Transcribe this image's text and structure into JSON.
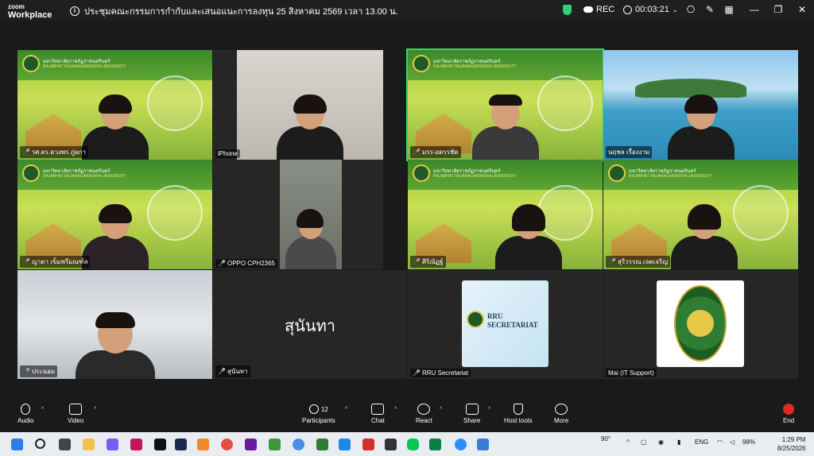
{
  "brand": {
    "line1": "zoom",
    "line2": "Workplace"
  },
  "meeting": {
    "title": "ประชุมคณะกรรมการกำกับและเสนอแนะการลงทุน 25 สิงหาคม 2569 เวลา 13.00 น."
  },
  "status": {
    "rec_label": "REC",
    "timer": "00:03:21"
  },
  "participants": [
    {
      "name": "รศ.ดร.ดวงพร ภู่ผกา",
      "muted": true
    },
    {
      "name": "iPhone",
      "muted": false
    },
    {
      "name": "มรร-อดรรชัด",
      "muted": true
    },
    {
      "name": "นฤชล เรื่องงาม",
      "muted": false
    },
    {
      "name": "ญาดา เข็มพรีมณฑ์ล",
      "muted": true
    },
    {
      "name": "OPPO CPH2365",
      "muted": true
    },
    {
      "name": "ศิริณัฏฐ์",
      "muted": true
    },
    {
      "name": "สุรีวรรณ เจตเจริญ",
      "muted": true
    },
    {
      "name": "ประนอม",
      "muted": true
    },
    {
      "name": "สุนันทา",
      "muted": true
    },
    {
      "name": "RRU Secretariat",
      "muted": true
    },
    {
      "name": "Mai (IT Support)",
      "muted": false
    }
  ],
  "banner": {
    "university_th": "มหาวิทยาลัยราชภัฏราชนครินทร์",
    "university_en": "RAJABHAT RAJANAGARINDRA UNIVERSITY"
  },
  "center_name": "สุนันทา",
  "secretariat_logo": {
    "line1": "RRU",
    "line2": "SECRETARIAT"
  },
  "toolbar": {
    "audio": "Audio",
    "video": "Video",
    "participants": "Participants",
    "participants_count": "12",
    "chat": "Chat",
    "react": "React",
    "share": "Share",
    "host_tools": "Host tools",
    "more": "More",
    "end": "End"
  },
  "taskbar": {
    "weather": "90°",
    "language": "ENG",
    "battery": "98%",
    "time": "1:29 PM",
    "date": "8/25/2026"
  },
  "colors": {
    "accent_green": "#2fd07a",
    "end_red": "#e02828",
    "tile_green": "#9ccc3a"
  }
}
